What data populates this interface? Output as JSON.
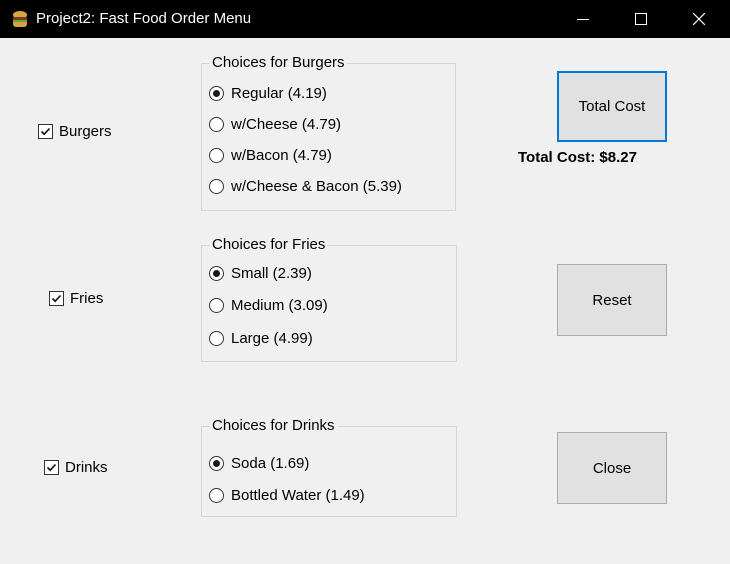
{
  "window": {
    "title": "Project2: Fast Food Order Menu",
    "icon": "food-app-icon",
    "controls": [
      "minimize-icon",
      "maximize-icon",
      "close-icon"
    ]
  },
  "categories": {
    "burgers": {
      "label": "Burgers",
      "checked": true
    },
    "fries": {
      "label": "Fries",
      "checked": true
    },
    "drinks": {
      "label": "Drinks",
      "checked": true
    }
  },
  "groups": {
    "burgers": {
      "title": "Choices for Burgers",
      "options": [
        {
          "label": "Regular (4.19)",
          "selected": true
        },
        {
          "label": "w/Cheese (4.79)",
          "selected": false
        },
        {
          "label": "w/Bacon (4.79)",
          "selected": false
        },
        {
          "label": "w/Cheese & Bacon (5.39)",
          "selected": false
        }
      ]
    },
    "fries": {
      "title": "Choices for Fries",
      "options": [
        {
          "label": "Small (2.39)",
          "selected": true
        },
        {
          "label": "Medium (3.09)",
          "selected": false
        },
        {
          "label": "Large (4.99)",
          "selected": false
        }
      ]
    },
    "drinks": {
      "title": "Choices for Drinks",
      "options": [
        {
          "label": "Soda (1.69)",
          "selected": true
        },
        {
          "label": "Bottled Water (1.49)",
          "selected": false
        }
      ]
    }
  },
  "buttons": {
    "total": "Total Cost",
    "reset": "Reset",
    "close": "Close"
  },
  "total_cost_text": "Total Cost: $8.27",
  "colors": {
    "titlebar": "#000000",
    "window_bg": "#f0f0f0",
    "button_bg": "#e1e1e1",
    "focus_border": "#0078d7"
  }
}
